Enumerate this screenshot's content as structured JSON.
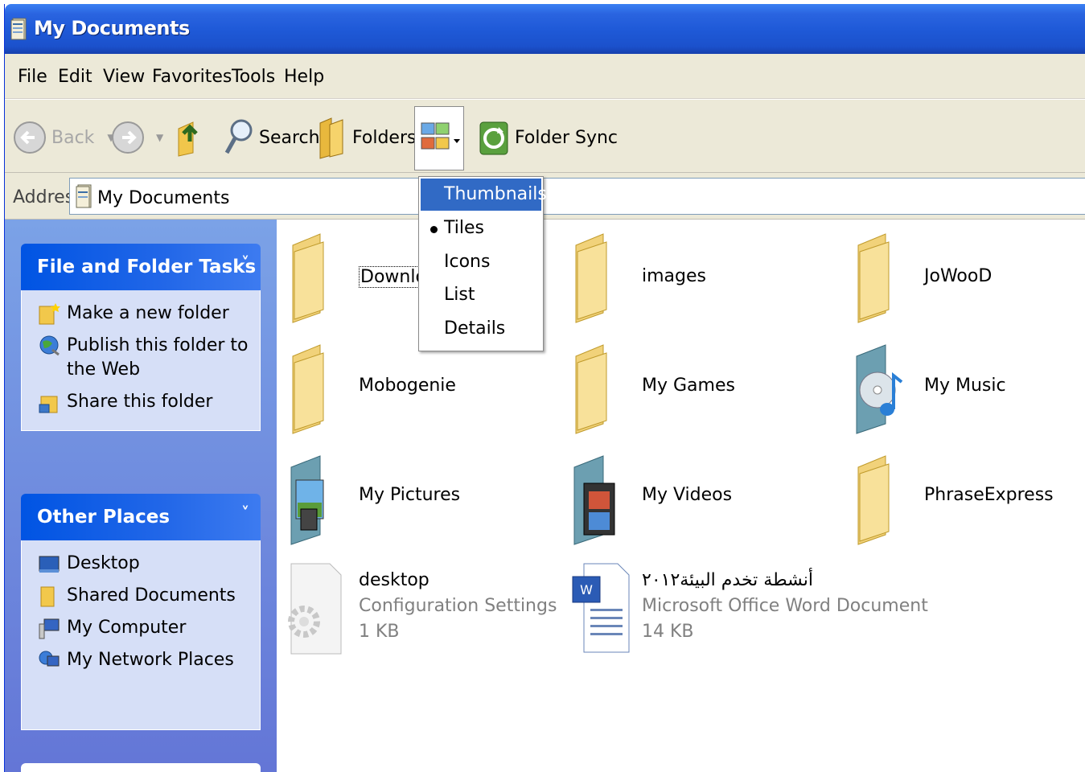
{
  "window": {
    "title": "My Documents"
  },
  "menu": [
    "File",
    "Edit",
    "View",
    "Favorites",
    "Tools",
    "Help"
  ],
  "toolbar": {
    "back": "Back",
    "search": "Search",
    "folders": "Folders",
    "folder_sync": "Folder Sync"
  },
  "address": {
    "label": "Address",
    "value": "My Documents"
  },
  "views_menu": {
    "items": [
      "Thumbnails",
      "Tiles",
      "Icons",
      "List",
      "Details"
    ],
    "highlighted": "Thumbnails",
    "checked": "Tiles"
  },
  "left_pane": {
    "file_tasks": {
      "title": "File and Folder Tasks",
      "items": [
        "Make a new folder",
        "Publish this folder to the Web",
        "Share this folder"
      ]
    },
    "other_places": {
      "title": "Other Places",
      "items": [
        "Desktop",
        "Shared Documents",
        "My Computer",
        "My Network Places"
      ]
    }
  },
  "files": [
    {
      "name": "Downloads",
      "type": "folder"
    },
    {
      "name": "images",
      "type": "folder"
    },
    {
      "name": "JoWooD",
      "type": "folder"
    },
    {
      "name": "Mobogenie",
      "type": "folder"
    },
    {
      "name": "My Games",
      "type": "folder"
    },
    {
      "name": "My Music",
      "type": "music-folder"
    },
    {
      "name": "My Pictures",
      "type": "pictures-folder"
    },
    {
      "name": "My Videos",
      "type": "videos-folder"
    },
    {
      "name": "PhraseExpress",
      "type": "folder"
    },
    {
      "name": "desktop",
      "type": "config",
      "kind": "Configuration Settings",
      "size": "1 KB"
    },
    {
      "name": "أنشطة تخدم البيئة٢٠١٢",
      "type": "word",
      "kind": "Microsoft Office Word Document",
      "size": "14 KB"
    }
  ]
}
